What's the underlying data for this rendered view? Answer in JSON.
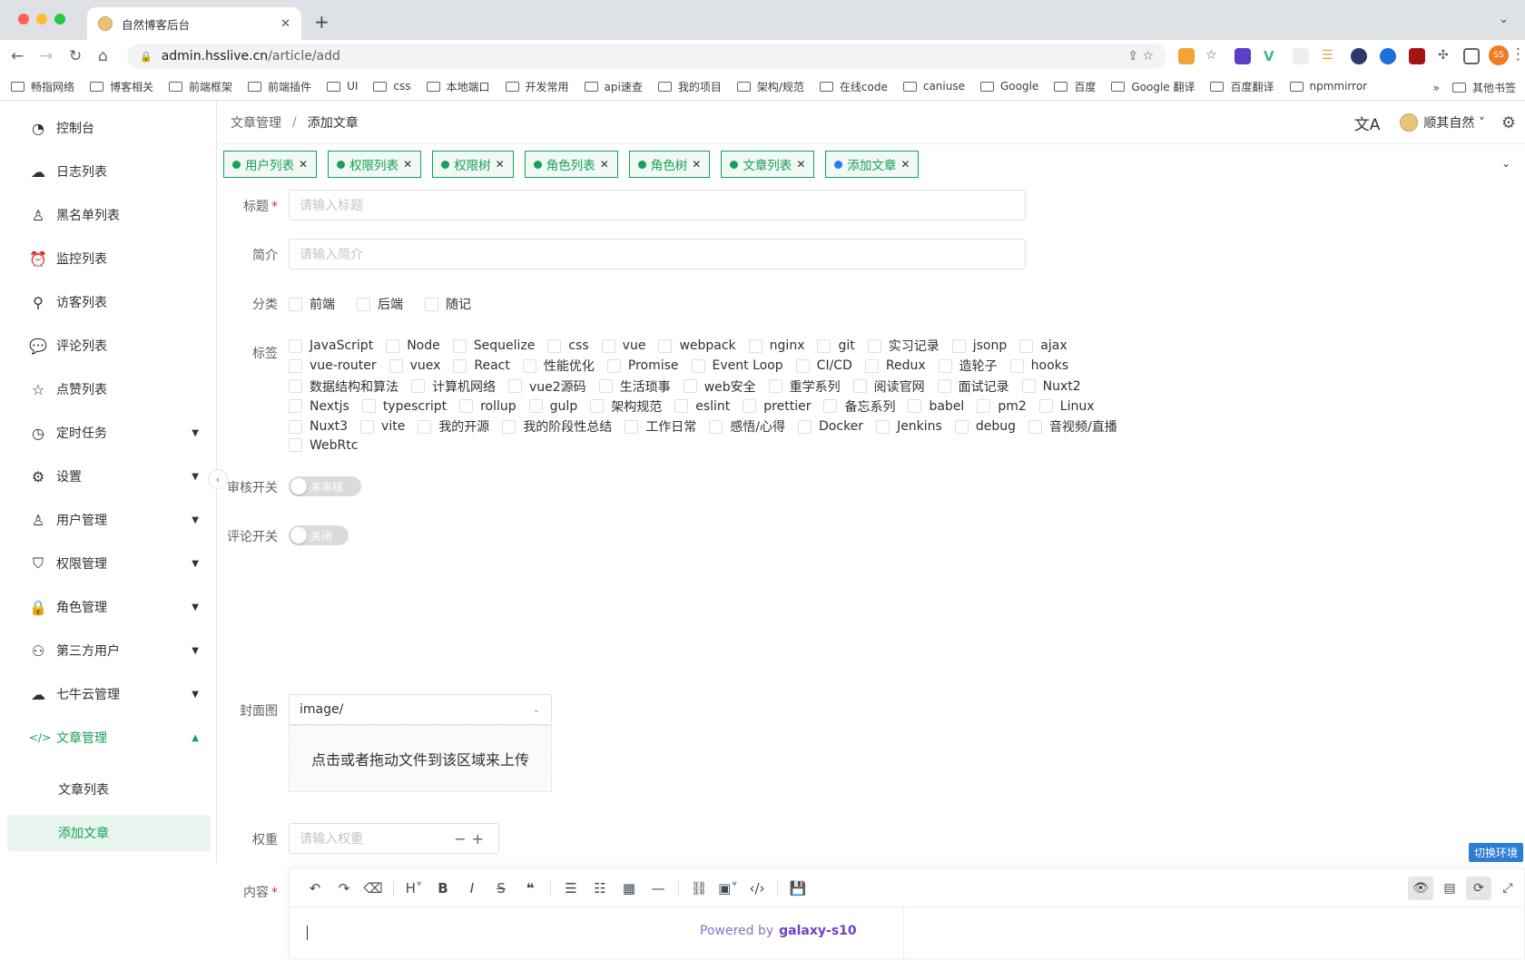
{
  "browser": {
    "tab_title": "自然博客后台",
    "url_host": "admin.hsslive.cn",
    "url_path": "/article/add",
    "bookmarks": [
      "畅指网络",
      "博客相关",
      "前端框架",
      "前端插件",
      "UI",
      "css",
      "本地端口",
      "开发常用",
      "api速查",
      "我的项目",
      "架构/规范",
      "在线code",
      "caniuse",
      "Google",
      "百度",
      "Google 翻译",
      "百度翻译",
      "npmmirror"
    ],
    "bookmarks_more": "»",
    "other_bookmarks": "其他书签",
    "profile_initials": "SS"
  },
  "sidebar": {
    "items": [
      {
        "label": "控制台",
        "icon": "dashboard-icon",
        "glyph": "◔"
      },
      {
        "label": "日志列表",
        "icon": "cloud-icon",
        "glyph": "☁"
      },
      {
        "label": "黑名单列表",
        "icon": "person-icon",
        "glyph": "♙"
      },
      {
        "label": "监控列表",
        "icon": "alarm-icon",
        "glyph": "⏰"
      },
      {
        "label": "访客列表",
        "icon": "footprint-icon",
        "glyph": "⚲"
      },
      {
        "label": "评论列表",
        "icon": "comment-icon",
        "glyph": "💬"
      },
      {
        "label": "点赞列表",
        "icon": "star-icon",
        "glyph": "☆"
      },
      {
        "label": "定时任务",
        "icon": "clock-icon",
        "glyph": "◷",
        "arrow": "▼"
      },
      {
        "label": "设置",
        "icon": "settings-icon",
        "glyph": "⚙",
        "arrow": "▼"
      },
      {
        "label": "用户管理",
        "icon": "user-icon",
        "glyph": "♙",
        "arrow": "▼"
      },
      {
        "label": "权限管理",
        "icon": "shield-icon",
        "glyph": "⛉",
        "arrow": "▼"
      },
      {
        "label": "角色管理",
        "icon": "lock-icon",
        "glyph": "🔒",
        "arrow": "▼"
      },
      {
        "label": "第三方用户",
        "icon": "users-icon",
        "glyph": "⚇",
        "arrow": "▼"
      },
      {
        "label": "七牛云管理",
        "icon": "cloud-upload-icon",
        "glyph": "☁",
        "arrow": "▼"
      },
      {
        "label": "文章管理",
        "icon": "code-icon",
        "glyph": "</>",
        "arrow": "▲",
        "active": true
      }
    ],
    "subitems": [
      {
        "label": "文章列表"
      },
      {
        "label": "添加文章",
        "selected": true
      }
    ],
    "collapse_glyph": "‹"
  },
  "header": {
    "breadcrumb_parent": "文章管理",
    "breadcrumb_sep": "/",
    "breadcrumb_current": "添加文章",
    "username": "顺其自然",
    "translate_glyph": "文A"
  },
  "tags": [
    {
      "label": "用户列表"
    },
    {
      "label": "权限列表"
    },
    {
      "label": "权限树"
    },
    {
      "label": "角色列表"
    },
    {
      "label": "角色树"
    },
    {
      "label": "文章列表"
    },
    {
      "label": "添加文章",
      "current": true
    }
  ],
  "form": {
    "title_label": "标题",
    "title_placeholder": "请输入标题",
    "desc_label": "简介",
    "desc_placeholder": "请输入简介",
    "category_label": "分类",
    "categories": [
      "前端",
      "后端",
      "随记"
    ],
    "tags_label": "标签",
    "tag_rows": [
      [
        "JavaScript",
        "Node",
        "Sequelize",
        "css",
        "vue",
        "webpack",
        "nginx",
        "git",
        "实习记录",
        "jsonp",
        "ajax"
      ],
      [
        "vue-router",
        "vuex",
        "React",
        "性能优化",
        "Promise",
        "Event Loop",
        "CI/CD",
        "Redux",
        "造轮子",
        "hooks"
      ],
      [
        "数据结构和算法",
        "计算机网络",
        "vue2源码",
        "生活琐事",
        "web安全",
        "重学系列",
        "阅读官网",
        "面试记录",
        "Nuxt2"
      ],
      [
        "Nextjs",
        "typescript",
        "rollup",
        "gulp",
        "架构规范",
        "eslint",
        "prettier",
        "备忘系列",
        "babel",
        "pm2",
        "Linux"
      ],
      [
        "Nuxt3",
        "vite",
        "我的开源",
        "我的阶段性总结",
        "工作日常",
        "感悟/心得",
        "Docker",
        "Jenkins",
        "debug",
        "音视频/直播"
      ],
      [
        "WebRtc"
      ]
    ],
    "audit_label": "审核开关",
    "audit_state": "未审核",
    "comment_label": "评论开关",
    "comment_state": "关闭",
    "cover_label": "封面图",
    "cover_select": "image/",
    "upload_text": "点击或者拖动文件到该区域来上传",
    "weight_label": "权重",
    "weight_placeholder": "请输入权重",
    "content_label": "内容",
    "required_mark": "*"
  },
  "editor": {
    "powered_prefix": "Powered by",
    "powered_name": "galaxy-s10"
  },
  "env_button": "切换环境",
  "colors": {
    "accent": "#18a058",
    "current_tag_dot": "#2080f0"
  }
}
